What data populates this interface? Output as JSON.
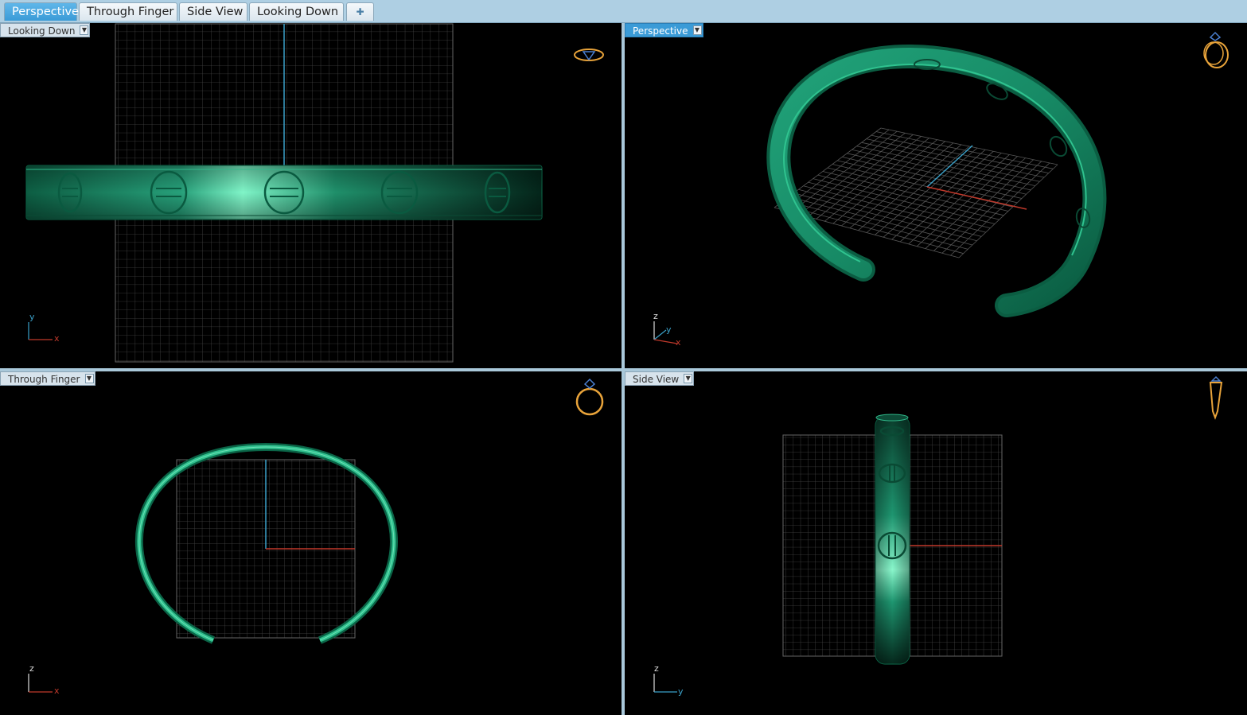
{
  "tabs": [
    {
      "label": "Perspective",
      "active": true
    },
    {
      "label": "Through Finger",
      "active": false
    },
    {
      "label": "Side View",
      "active": false
    },
    {
      "label": "Looking Down",
      "active": false
    }
  ],
  "add_tab_icon": "add-tab-icon",
  "viewports": {
    "top_left": {
      "label": "Looking Down",
      "axes": [
        "y",
        "x"
      ]
    },
    "top_right": {
      "label": "Perspective",
      "axes": [
        "z",
        "y",
        "x"
      ]
    },
    "bottom_left": {
      "label": "Through Finger",
      "axes": [
        "z",
        "x"
      ]
    },
    "bottom_right": {
      "label": "Side View",
      "axes": [
        "z",
        "y"
      ]
    }
  },
  "colors": {
    "background": "#000000",
    "grid": "#4a4a4a",
    "model_green": "#1fa877",
    "model_highlight": "#7df0c4",
    "axis_x": "#c0392b",
    "axis_y": "#3aa0c8",
    "axis_z": "#dddddd",
    "tab_active": "#3a9bd7",
    "ring_icon": "#e8a33a"
  }
}
